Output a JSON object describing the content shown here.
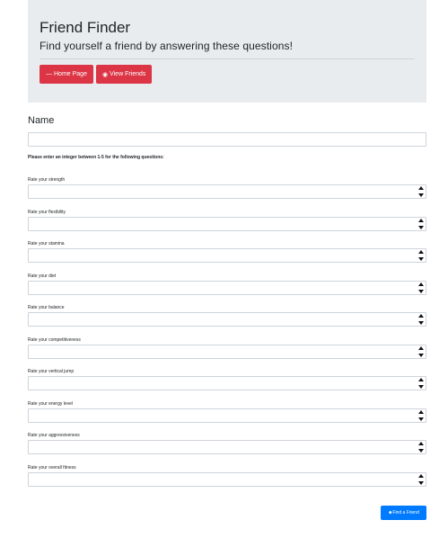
{
  "header": {
    "title": "Friend Finder",
    "subtitle": "Find yourself a friend by answering these questions!",
    "buttons": [
      {
        "label": "Home Page",
        "icon": "minus-icon"
      },
      {
        "label": "View Friends",
        "icon": "eye-icon"
      }
    ]
  },
  "form": {
    "name_label": "Name",
    "name_value": "",
    "instructions": "Please enter an integer between 1-5 for the following questions:",
    "questions": [
      {
        "label": "Rate your strength",
        "value": ""
      },
      {
        "label": "Rate your flexibility",
        "value": ""
      },
      {
        "label": "Rate your stamina",
        "value": ""
      },
      {
        "label": "Rate your diet",
        "value": ""
      },
      {
        "label": "Rate your balance",
        "value": ""
      },
      {
        "label": "Rate your competitiveness",
        "value": ""
      },
      {
        "label": "Rate your vertical jump",
        "value": ""
      },
      {
        "label": "Rate your energy level",
        "value": ""
      },
      {
        "label": "Rate your aggressiveness",
        "value": ""
      },
      {
        "label": "Rate your overall fitness",
        "value": ""
      }
    ],
    "submit_label": "Find a Friend",
    "submit_icon": "user-plus-icon"
  },
  "colors": {
    "jumbotron_bg": "#e9ecef",
    "danger": "#dc3545",
    "primary": "#007bff"
  }
}
